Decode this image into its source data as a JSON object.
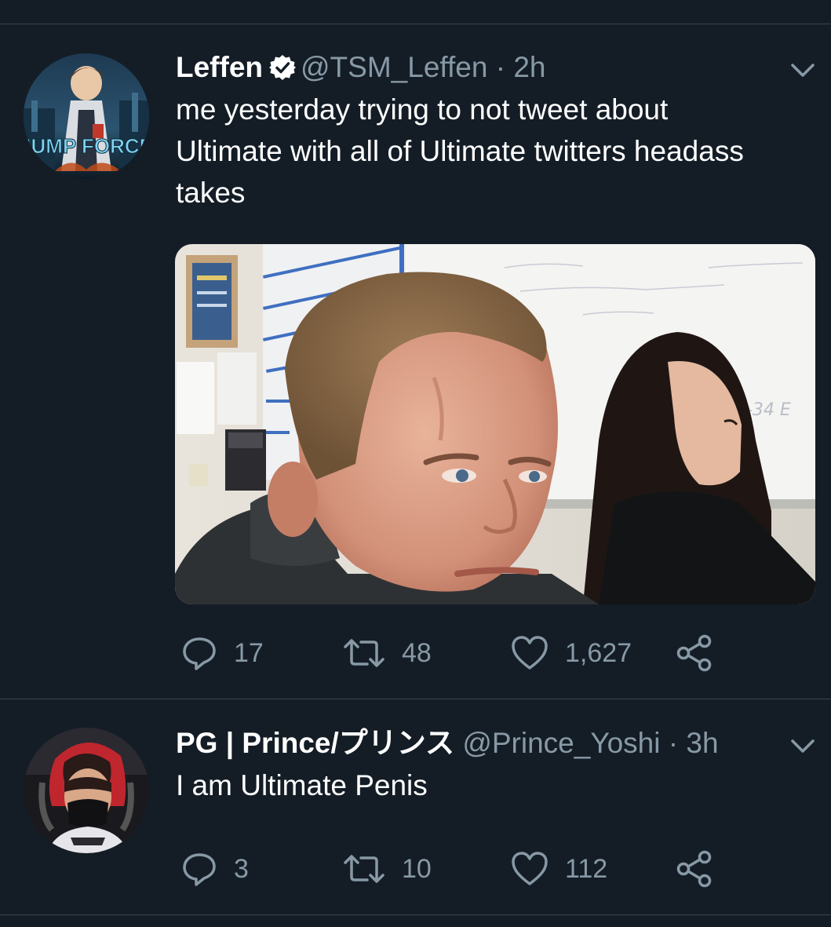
{
  "tweets": [
    {
      "author": {
        "name": "Leffen",
        "handle": "@TSM_Leffen",
        "time": "· 2h",
        "verified": true,
        "avatar_text": "JUMP FORCE"
      },
      "text_lines": [
        "me yesterday trying to not tweet about",
        "Ultimate with all of Ultimate twitters headass",
        "takes"
      ],
      "media": {
        "kind": "gif-frame",
        "whiteboard_text": "4-34 E"
      },
      "actions": {
        "replies": "17",
        "retweets": "48",
        "likes": "1,627"
      }
    },
    {
      "author": {
        "name": "PG | Prince/プリンス",
        "handle": "@Prince_Yoshi",
        "time": "· 3h",
        "verified": false
      },
      "text_lines": [
        "I am Ultimate Penis"
      ],
      "actions": {
        "replies": "3",
        "retweets": "10",
        "likes": "112"
      }
    }
  ],
  "icons": {
    "reply": "reply-icon",
    "retweet": "retweet-icon",
    "like": "heart-icon",
    "share": "share-icon",
    "more": "chevron-down-icon",
    "verified": "verified-badge-icon"
  },
  "colors": {
    "background": "#141d26",
    "divider": "#38444d",
    "secondary_text": "#8899a6",
    "verified_badge": "#ffffff"
  }
}
